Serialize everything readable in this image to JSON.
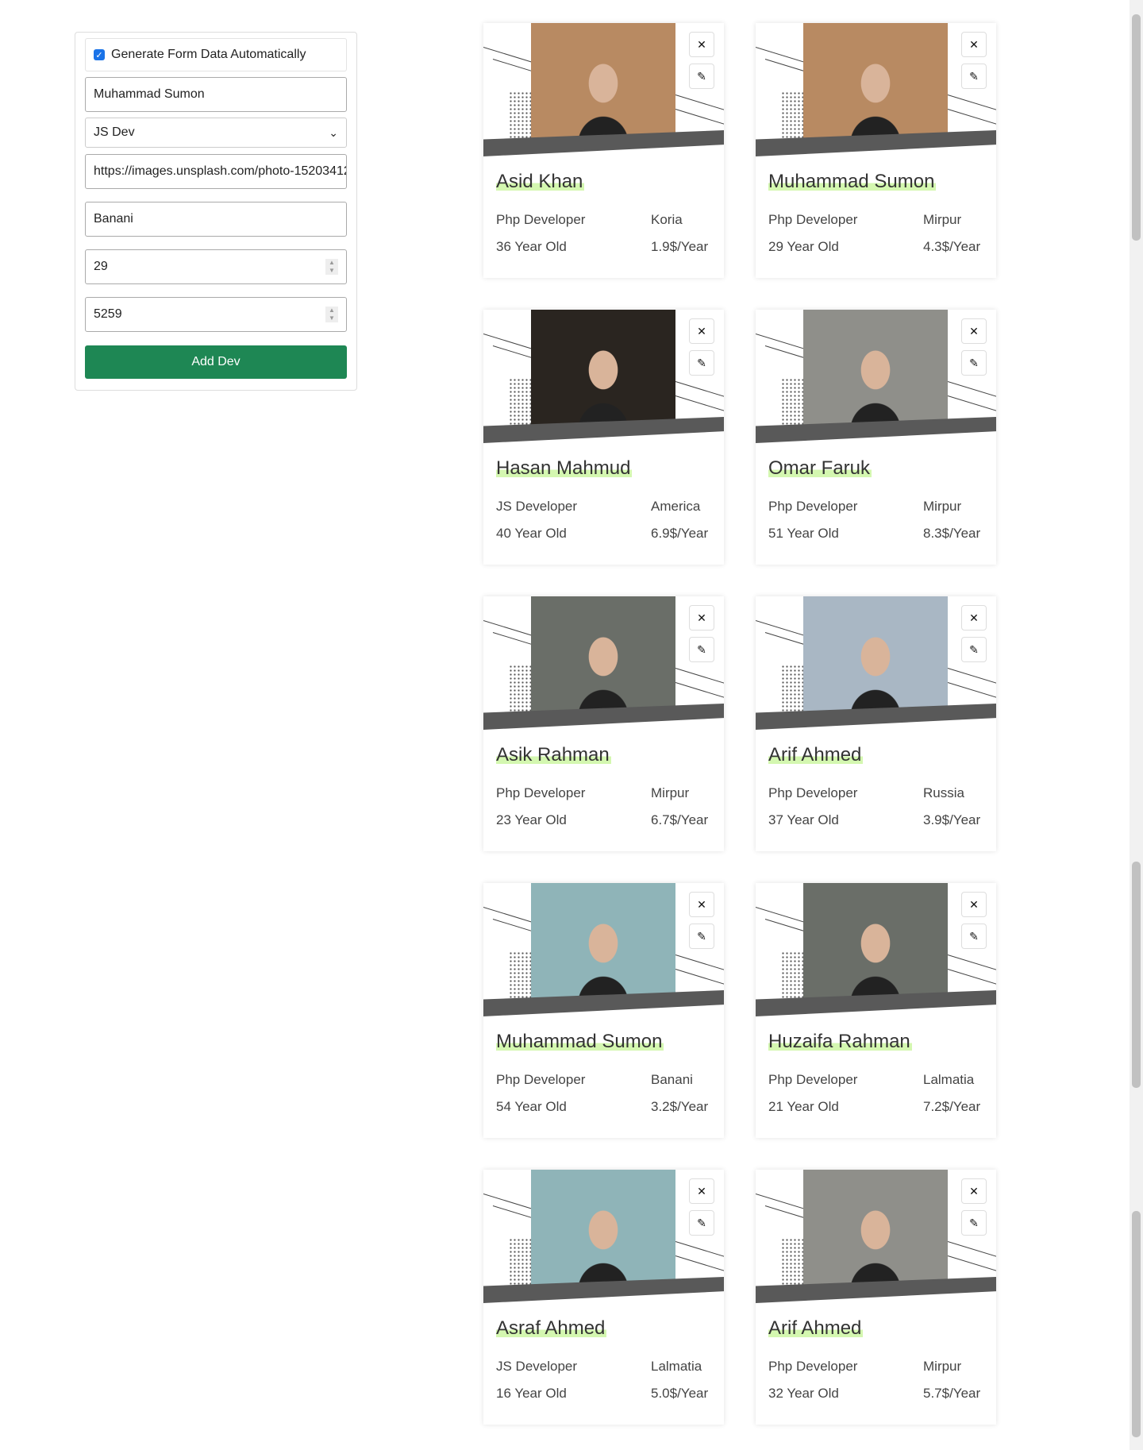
{
  "form": {
    "auto_label": "Generate Form Data Automatically",
    "auto_checked": true,
    "name": "Muhammad Sumon",
    "role": "JS Dev",
    "image_url": "https://images.unsplash.com/photo-15203412",
    "location": "Banani",
    "age": "29",
    "salary": "5259",
    "submit": "Add Dev"
  },
  "cards": [
    {
      "name": "Asid Khan",
      "role": "Php Developer",
      "location": "Koria",
      "age": "36 Year Old",
      "salary": "1.9$/Year",
      "photo": "#b88a62"
    },
    {
      "name": "Muhammad Sumon",
      "role": "Php Developer",
      "location": "Mirpur",
      "age": "29 Year Old",
      "salary": "4.3$/Year",
      "photo": "#b88a62"
    },
    {
      "name": "Hasan Mahmud",
      "role": "JS Developer",
      "location": "America",
      "age": "40 Year Old",
      "salary": "6.9$/Year",
      "photo": "#2a2520"
    },
    {
      "name": "Omar Faruk",
      "role": "Php Developer",
      "location": "Mirpur",
      "age": "51 Year Old",
      "salary": "8.3$/Year",
      "photo": "#8f8f8a"
    },
    {
      "name": "Asik Rahman",
      "role": "Php Developer",
      "location": "Mirpur",
      "age": "23 Year Old",
      "salary": "6.7$/Year",
      "photo": "#6a6e68"
    },
    {
      "name": "Arif Ahmed",
      "role": "Php Developer",
      "location": "Russia",
      "age": "37 Year Old",
      "salary": "3.9$/Year",
      "photo": "#a9b7c4"
    },
    {
      "name": "Muhammad Sumon",
      "role": "Php Developer",
      "location": "Banani",
      "age": "54 Year Old",
      "salary": "3.2$/Year",
      "photo": "#8fb4b8"
    },
    {
      "name": "Huzaifa Rahman",
      "role": "Php Developer",
      "location": "Lalmatia",
      "age": "21 Year Old",
      "salary": "7.2$/Year",
      "photo": "#6a6e68"
    },
    {
      "name": "Asraf Ahmed",
      "role": "JS Developer",
      "location": "Lalmatia",
      "age": "16 Year Old",
      "salary": "5.0$/Year",
      "photo": "#8fb4b8"
    },
    {
      "name": "Arif Ahmed",
      "role": "Php Developer",
      "location": "Mirpur",
      "age": "32 Year Old",
      "salary": "5.7$/Year",
      "photo": "#8f8f8a"
    }
  ]
}
